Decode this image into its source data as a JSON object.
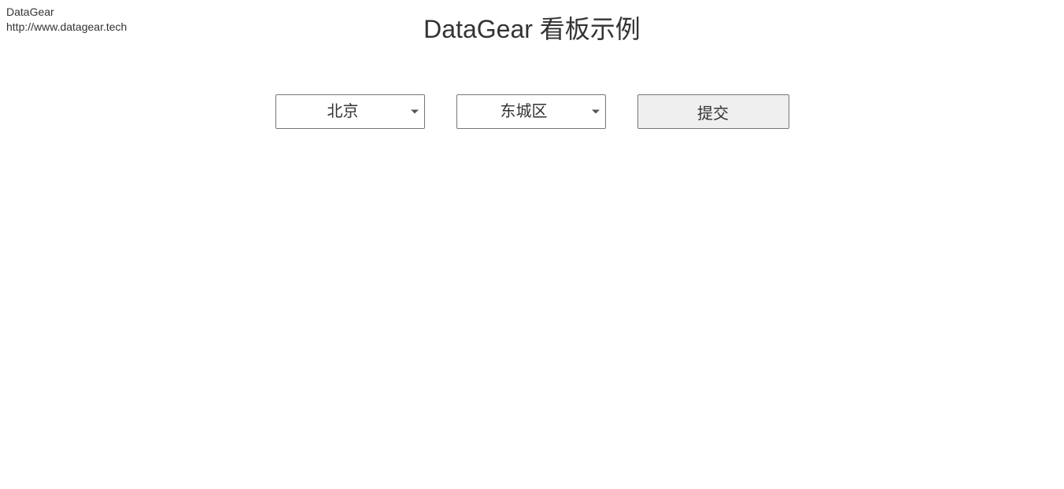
{
  "header": {
    "brand": "DataGear",
    "url": "http://www.datagear.tech",
    "title": "DataGear 看板示例"
  },
  "form": {
    "city_select": {
      "selected": "北京"
    },
    "district_select": {
      "selected": "东城区"
    },
    "submit_label": "提交"
  }
}
